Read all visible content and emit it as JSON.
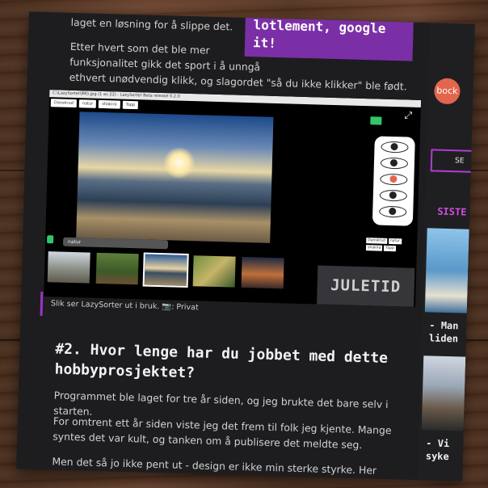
{
  "article": {
    "p_top": "laget en løsning for å slippe det.",
    "p_func_1": "Etter hvert som det ble mer",
    "p_func_2": "funksjonalitet gikk det sport i å unngå",
    "p_func_3": "ethvert unødvendig klikk, og slagordet \"så du ikke klikker\" ble født.",
    "banner_1": "lotlement, google",
    "banner_2": "it!",
    "caption": "Slik ser LazySorter ut i bruk. 📷: Privat",
    "heading": "#2. Hvor lenge har du jobbet med dette hobbyprosjektet?",
    "p1": "Programmet ble laget for tre år siden, og jeg brukte det bare selv i starten.",
    "p2": "For omtrent ett år siden viste jeg det frem til folk jeg kjente. Mange syntes det var kult, og tanken om å publisere det meldte seg.",
    "p3": "Men det så jo ikke pent ut - design er ikke min sterke styrke. Her kom min"
  },
  "screenshot": {
    "window_title": "C:\\LazySorter\\IMG.jpg (1 av 22) - LazySorter Beta release 0.2.0",
    "tags": [
      "Danskrud",
      "natur",
      "shakira",
      "Topp"
    ],
    "tag_input": "natur",
    "mini_tags": [
      "Danskrud",
      "natur",
      "shakira",
      "Topp"
    ],
    "overlay": "JULETID"
  },
  "sidebar": {
    "avatar": "bock",
    "search_button": "SE",
    "section": "SISTE",
    "item1_l1": "- Man",
    "item1_l2": "liden",
    "item2_l1": "- Vi",
    "item2_l2": "syke"
  },
  "colors": {
    "accent": "#9b34c8",
    "banner": "#7b2fa6",
    "avatar": "#e2664d"
  }
}
